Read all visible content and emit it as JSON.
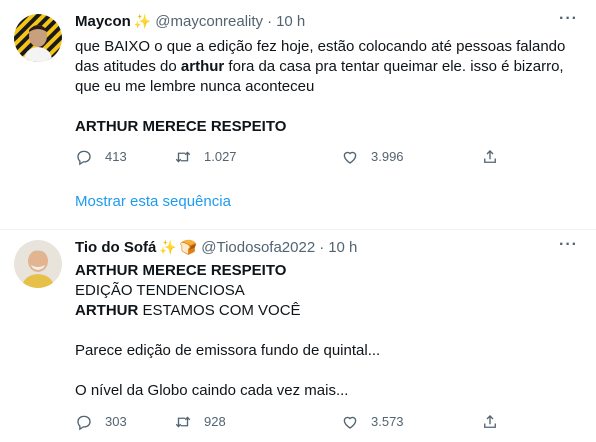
{
  "tweets": [
    {
      "name": "Maycon",
      "handle": "@mayconreality",
      "time": "10 h",
      "emoji_sparkle": "✨",
      "lines": [
        [
          {
            "t": "que BAIXO o que a edição fez hoje, estão colocando até pessoas falando",
            "b": false
          }
        ],
        [
          {
            "t": "das atitudes do ",
            "b": false
          },
          {
            "t": "arthur",
            "b": true
          },
          {
            "t": " fora da casa pra tentar queimar ele. isso é bizarro,",
            "b": false
          }
        ],
        [
          {
            "t": "que eu me lembre nunca aconteceu",
            "b": false
          }
        ],
        [],
        [
          {
            "t": "ARTHUR MERECE RESPEITO",
            "b": true
          }
        ]
      ],
      "replies": "413",
      "retweets": "1.027",
      "likes": "3.996"
    },
    {
      "name": "Tio do Sofá",
      "handle": "@Tiodosofa2022",
      "time": "10 h",
      "emoji_sparkle": "✨",
      "emoji_bread": "🍞",
      "lines": [
        [
          {
            "t": "ARTHUR MERECE RESPEITO",
            "b": true
          }
        ],
        [
          {
            "t": "EDIÇÃO TENDENCIOSA",
            "b": false
          }
        ],
        [
          {
            "t": "ARTHUR",
            "b": true
          },
          {
            "t": " ESTAMOS COM VOCÊ",
            "b": false
          }
        ],
        [],
        [
          {
            "t": "Parece edição de emissora fundo de quintal...",
            "b": false
          }
        ],
        [],
        [
          {
            "t": "O nível da Globo caindo cada vez mais...",
            "b": false
          }
        ]
      ],
      "replies": "303",
      "retweets": "928",
      "likes": "3.573"
    }
  ],
  "show_thread": "Mostrar esta sequência",
  "colors": {
    "accent": "#1d9bf0",
    "secondary": "#536471",
    "divider": "#eff3f4"
  },
  "icons": [
    "more-icon",
    "reply-icon",
    "retweet-icon",
    "like-icon",
    "share-icon"
  ]
}
